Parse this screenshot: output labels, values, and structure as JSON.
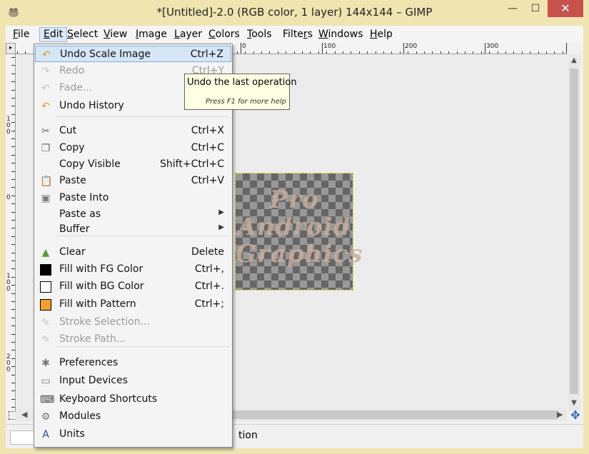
{
  "window": {
    "title": "*[Untitled]-2.0 (RGB color, 1 layer) 144x144 – GIMP",
    "minimize_glyph": "—",
    "maximize_glyph": "☐",
    "close_glyph": "✕"
  },
  "menubar": [
    {
      "pre": "",
      "u": "F",
      "post": "ile"
    },
    {
      "pre": "",
      "u": "E",
      "post": "dit"
    },
    {
      "pre": "",
      "u": "S",
      "post": "elect"
    },
    {
      "pre": "",
      "u": "V",
      "post": "iew"
    },
    {
      "pre": "",
      "u": "I",
      "post": "mage"
    },
    {
      "pre": "",
      "u": "L",
      "post": "ayer"
    },
    {
      "pre": "",
      "u": "C",
      "post": "olors"
    },
    {
      "pre": "",
      "u": "T",
      "post": "ools"
    },
    {
      "pre": "Filte",
      "u": "r",
      "post": "s"
    },
    {
      "pre": "",
      "u": "W",
      "post": "indows"
    },
    {
      "pre": "",
      "u": "H",
      "post": "elp"
    }
  ],
  "ruler": {
    "top_labels": [
      "0",
      "100",
      "200",
      "300",
      "4"
    ],
    "left_labels": [
      "1\n0\n0",
      "0",
      "1\n0\n0",
      "2\n0\n0"
    ]
  },
  "image_text": [
    "Pro",
    "Android",
    "Graphics"
  ],
  "edit_menu": {
    "items": [
      {
        "label": "Undo Scale Image",
        "shortcut": "Ctrl+Z",
        "icon": "undo-icon",
        "disabled": false
      },
      {
        "label": "Redo",
        "shortcut": "Ctrl+Y",
        "icon": "redo-icon",
        "disabled": true
      },
      {
        "label": "Fade...",
        "shortcut": "",
        "icon": "fade-icon",
        "disabled": true
      },
      {
        "label": "Undo History",
        "shortcut": "",
        "icon": "undo-history-icon",
        "disabled": false
      },
      {
        "label": "Cut",
        "shortcut": "Ctrl+X",
        "icon": "scissors-icon",
        "disabled": false
      },
      {
        "label": "Copy",
        "shortcut": "Ctrl+C",
        "icon": "copy-icon",
        "disabled": false
      },
      {
        "label": "Copy Visible",
        "shortcut": "Shift+Ctrl+C",
        "icon": "",
        "disabled": false
      },
      {
        "label": "Paste",
        "shortcut": "Ctrl+V",
        "icon": "paste-icon",
        "disabled": false
      },
      {
        "label": "Paste Into",
        "shortcut": "",
        "icon": "paste-into-icon",
        "disabled": false
      },
      {
        "label": "Paste as",
        "shortcut": "",
        "icon": "",
        "disabled": false,
        "submenu": true
      },
      {
        "label": "Buffer",
        "shortcut": "",
        "icon": "",
        "disabled": false,
        "submenu": true
      },
      {
        "label": "Clear",
        "shortcut": "Delete",
        "icon": "clear-icon",
        "disabled": false
      },
      {
        "label": "Fill with FG Color",
        "shortcut": "Ctrl+,",
        "icon": "fg-color-swatch-icon",
        "disabled": false
      },
      {
        "label": "Fill with BG Color",
        "shortcut": "Ctrl+.",
        "icon": "bg-color-swatch-icon",
        "disabled": false
      },
      {
        "label": "Fill with Pattern",
        "shortcut": "Ctrl+;",
        "icon": "pattern-swatch-icon",
        "disabled": false
      },
      {
        "label": "Stroke Selection...",
        "shortcut": "",
        "icon": "stroke-selection-icon",
        "disabled": true
      },
      {
        "label": "Stroke Path...",
        "shortcut": "",
        "icon": "stroke-path-icon",
        "disabled": true
      },
      {
        "label": "Preferences",
        "shortcut": "",
        "icon": "preferences-icon",
        "disabled": false
      },
      {
        "label": "Input Devices",
        "shortcut": "",
        "icon": "input-devices-icon",
        "disabled": false
      },
      {
        "label": "Keyboard Shortcuts",
        "shortcut": "",
        "icon": "keyboard-icon",
        "disabled": false
      },
      {
        "label": "Modules",
        "shortcut": "",
        "icon": "modules-icon",
        "disabled": false
      },
      {
        "label": "Units",
        "shortcut": "",
        "icon": "units-icon",
        "disabled": false
      }
    ]
  },
  "tooltip": {
    "text": "Undo the last operation",
    "help": "Press F1 for more help"
  },
  "status": {
    "text": "tion"
  },
  "colors": {
    "title_bg": "#f0e4b0",
    "close_button": "#c7524c",
    "menu_highlight": "#d5e6f7",
    "fg_color": "#000000",
    "bg_color": "#ffffff",
    "pattern_color": "#f4a030"
  }
}
